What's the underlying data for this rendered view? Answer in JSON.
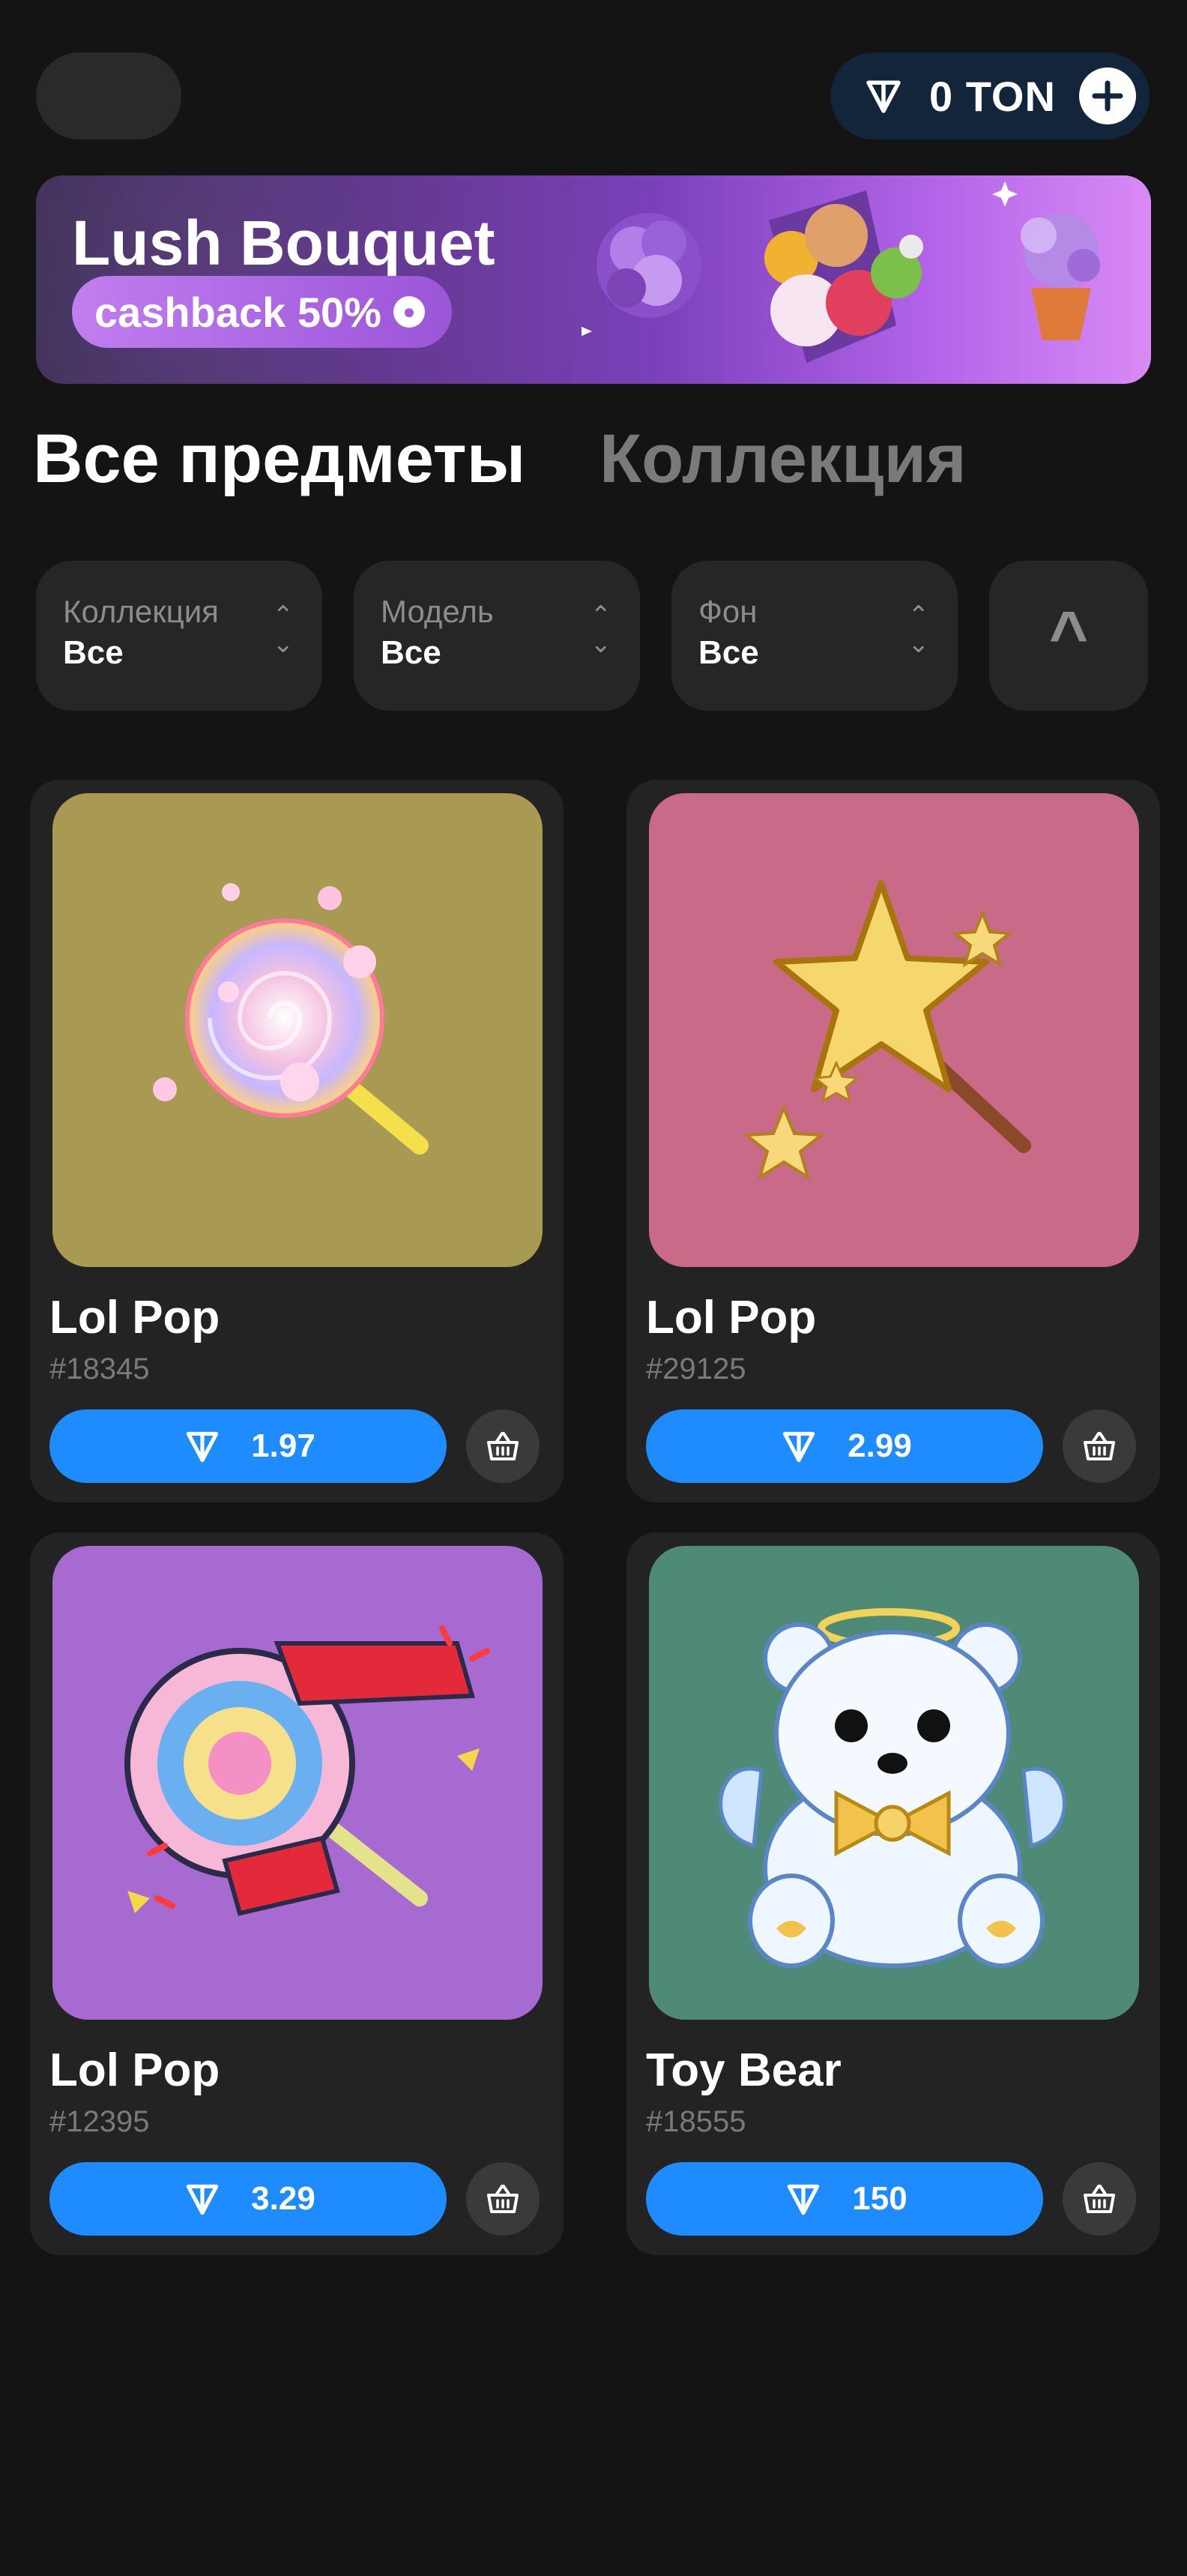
{
  "header": {
    "balance_label": "0 TON",
    "add_icon": "plus-icon",
    "currency_icon": "ton-icon"
  },
  "banner": {
    "title": "Lush Bouquet",
    "badge": "cashback 50%",
    "badge_icon": "fire-icon"
  },
  "tabs": [
    {
      "label": "Все предметы",
      "active": true
    },
    {
      "label": "Коллекция",
      "active": false
    }
  ],
  "filters": [
    {
      "label": "Коллекция",
      "value": "Все"
    },
    {
      "label": "Модель",
      "value": "Все"
    },
    {
      "label": "Фон",
      "value": "Все"
    }
  ],
  "sort_label": "^",
  "items": [
    {
      "title": "Lol Pop",
      "number": "#18345",
      "price": "1.97",
      "bg": "#a89a52"
    },
    {
      "title": "Lol Pop",
      "number": "#29125",
      "price": "2.99",
      "bg": "#c86a88"
    },
    {
      "title": "Lol Pop",
      "number": "#12395",
      "price": "3.29",
      "bg": "#a66ad0"
    },
    {
      "title": "Toy Bear",
      "number": "#18555",
      "price": "150",
      "bg": "#4e8a76"
    }
  ],
  "colors": {
    "background": "#141414",
    "accent": "#1e8bff",
    "card": "#232323",
    "muted": "#7a7a7a"
  }
}
